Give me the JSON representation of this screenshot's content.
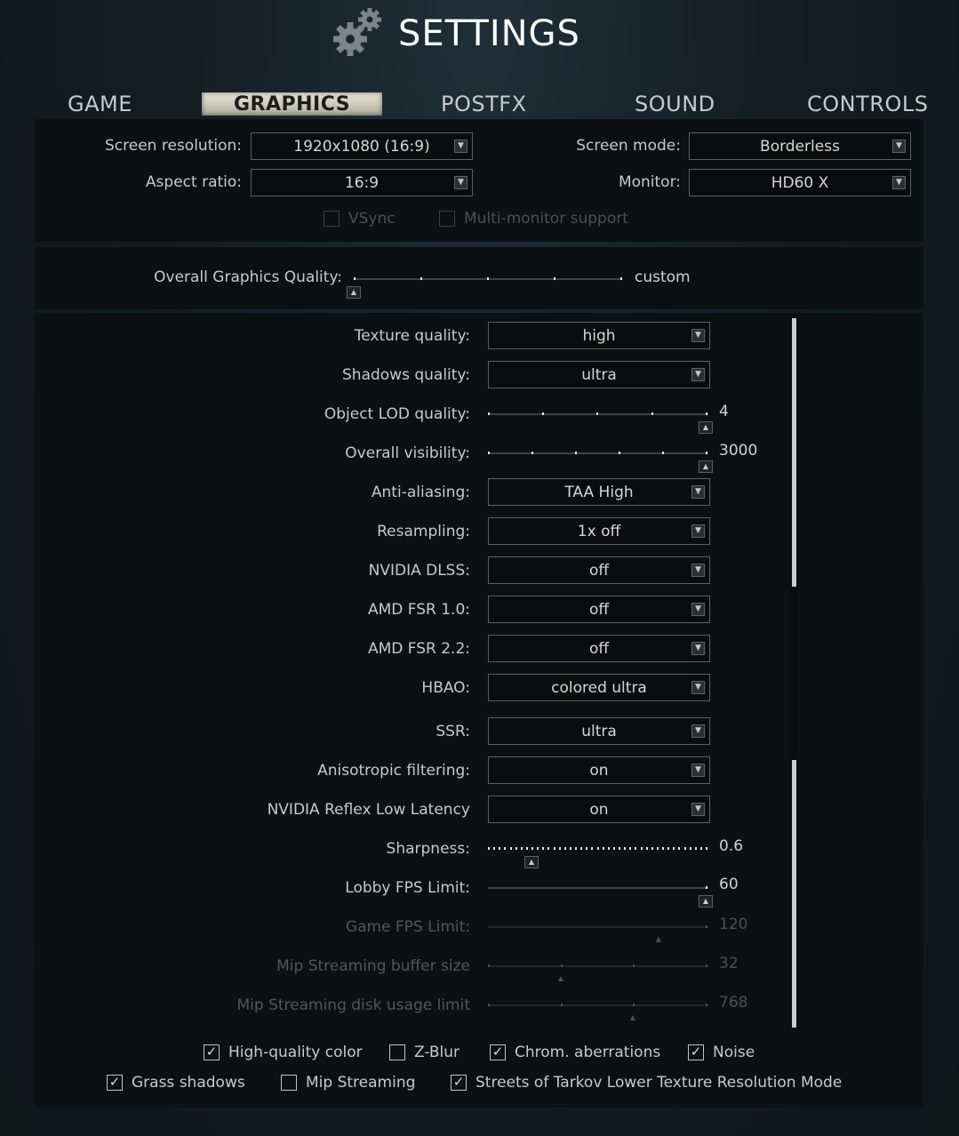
{
  "title": "SETTINGS",
  "tabs": [
    {
      "label": "GAME"
    },
    {
      "label": "GRAPHICS",
      "active": true
    },
    {
      "label": "POSTFX"
    },
    {
      "label": "SOUND"
    },
    {
      "label": "CONTROLS"
    }
  ],
  "display": {
    "screen_resolution": {
      "label": "Screen resolution:",
      "value": "1920x1080 (16:9)"
    },
    "aspect_ratio": {
      "label": "Aspect ratio:",
      "value": "16:9"
    },
    "screen_mode": {
      "label": "Screen mode:",
      "value": "Borderless"
    },
    "monitor": {
      "label": "Monitor:",
      "value": "HD60 X"
    },
    "vsync": {
      "label": "VSync",
      "checked": false
    },
    "multi_monitor": {
      "label": "Multi-monitor support",
      "checked": false
    }
  },
  "overall_quality": {
    "label": "Overall Graphics Quality:",
    "value": "custom"
  },
  "settings": {
    "texture_quality": {
      "label": "Texture quality:",
      "value": "high"
    },
    "shadows_quality": {
      "label": "Shadows quality:",
      "value": "ultra"
    },
    "object_lod": {
      "label": "Object LOD quality:",
      "value": "4"
    },
    "overall_visibility": {
      "label": "Overall visibility:",
      "value": "3000"
    },
    "anti_aliasing": {
      "label": "Anti-aliasing:",
      "value": "TAA High"
    },
    "resampling": {
      "label": "Resampling:",
      "value": "1x off"
    },
    "nvidia_dlss": {
      "label": "NVIDIA DLSS:",
      "value": "off"
    },
    "amd_fsr_10": {
      "label": "AMD FSR 1.0:",
      "value": "off"
    },
    "amd_fsr_22": {
      "label": "AMD FSR 2.2:",
      "value": "off"
    },
    "hbao": {
      "label": "HBAO:",
      "value": "colored ultra"
    },
    "ssr": {
      "label": "SSR:",
      "value": "ultra"
    },
    "anisotropic": {
      "label": "Anisotropic filtering:",
      "value": "on"
    },
    "reflex": {
      "label": "NVIDIA Reflex Low Latency",
      "value": "on"
    },
    "sharpness": {
      "label": "Sharpness:",
      "value": "0.6"
    },
    "lobby_fps": {
      "label": "Lobby FPS Limit:",
      "value": "60"
    },
    "game_fps": {
      "label": "Game FPS Limit:",
      "value": "120"
    },
    "mip_buffer": {
      "label": "Mip Streaming buffer size",
      "value": "32"
    },
    "mip_disk": {
      "label": "Mip Streaming disk usage limit",
      "value": "768"
    }
  },
  "checkboxes": {
    "hq_color": {
      "label": "High-quality color",
      "checked": true
    },
    "z_blur": {
      "label": "Z-Blur",
      "checked": false
    },
    "chrom": {
      "label": "Chrom. aberrations",
      "checked": true
    },
    "noise": {
      "label": "Noise",
      "checked": true
    },
    "grass": {
      "label": "Grass shadows",
      "checked": true
    },
    "mip_streaming": {
      "label": "Mip Streaming",
      "checked": false
    },
    "streets_lowres": {
      "label": "Streets of Tarkov Lower Texture Resolution Mode",
      "checked": true
    }
  },
  "icons": {
    "dropdown": "chevron-down-icon",
    "slider_thumb": "caret-up-icon",
    "check": "checkmark-icon",
    "title": "gears-icon"
  }
}
